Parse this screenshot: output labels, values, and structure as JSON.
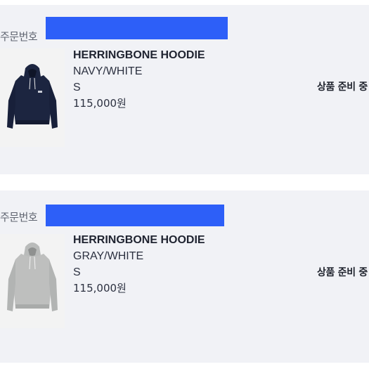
{
  "orders": [
    {
      "order_label": "주문번호",
      "product_name": "HERRINGBONE HOODIE",
      "color_option": "NAVY/WHITE",
      "size": "S",
      "price": "115,000원",
      "status": "상품 준비 중",
      "image_icon": "navy-hoodie-icon",
      "image_color": "#1c2540"
    },
    {
      "order_label": "주문번호",
      "product_name": "HERRINGBONE HOODIE",
      "color_option": "GRAY/WHITE",
      "size": "S",
      "price": "115,000원",
      "status": "상품 준비 중",
      "image_icon": "gray-hoodie-icon",
      "image_color": "#b9bbba"
    }
  ],
  "colors": {
    "card_background": "#f1f2f6",
    "redaction_blue": "#2d5ff8"
  }
}
